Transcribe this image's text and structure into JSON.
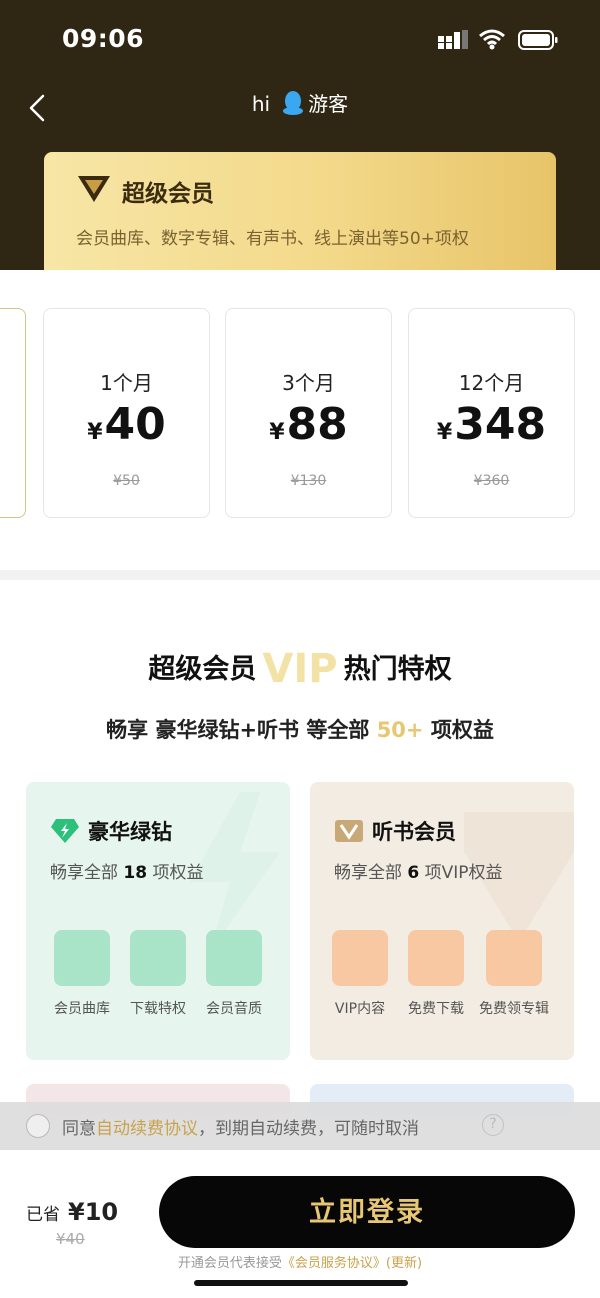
{
  "status": {
    "time": "09:06"
  },
  "header": {
    "greeting": "hi",
    "user": "游客"
  },
  "vip_card": {
    "title": "超级会员",
    "subtitle": "会员曲库、数字专辑、有声书、线上演出等50+项权"
  },
  "plans": [
    {
      "duration": "1个月",
      "currency": "¥",
      "price": "40",
      "original": "¥50"
    },
    {
      "duration": "3个月",
      "currency": "¥",
      "price": "88",
      "original": "¥130"
    },
    {
      "duration": "12个月",
      "currency": "¥",
      "price": "348",
      "original": "¥360"
    }
  ],
  "privileges": {
    "heading_pre": "超级会员",
    "heading_vip": "VIP",
    "heading_post": "热门特权",
    "sub_pre": "畅享 豪华绿钻+听书 等全部",
    "sub_num": "50+",
    "sub_post": "项权益",
    "cards": [
      {
        "title": "豪华绿钻",
        "desc_pre": "畅享全部",
        "desc_num": "18",
        "desc_post": "项权益",
        "features": [
          "会员曲库",
          "下载特权",
          "会员音质"
        ]
      },
      {
        "title": "听书会员",
        "desc_pre": "畅享全部",
        "desc_num": "6",
        "desc_post": "项VIP权益",
        "features": [
          "VIP内容",
          "免费下载",
          "免费领专辑"
        ]
      }
    ]
  },
  "agreement": {
    "pre": "同意",
    "link": "自动续费协议",
    "post": "，到期自动续费，可随时取消",
    "help": "?"
  },
  "footer": {
    "saved_label": "已省",
    "saved_amount": "¥10",
    "original_total": "¥40",
    "login_label": "立即登录",
    "terms_pre": "开通会员代表接受",
    "terms_link": "《会员服务协议》(更新)"
  },
  "colors": {
    "hero_bg": "#2f2614",
    "gold": "#e8c774",
    "green_card": "#e6f5ee",
    "tan_card": "#f2ece3"
  }
}
